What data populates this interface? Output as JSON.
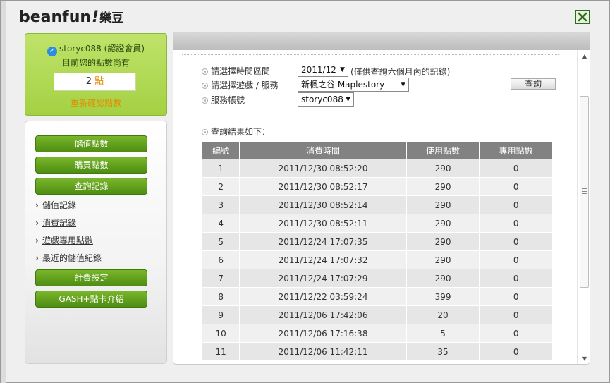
{
  "app": {
    "logo_text": "beanfun",
    "logo_bang": "!",
    "logo_cn": "樂豆"
  },
  "account": {
    "username_line": "storyc088 (認證會員)",
    "points_line": "目前您的點數尚有",
    "points_value": "2",
    "points_unit": "點",
    "recheck_label": "重新確認點數"
  },
  "menu": {
    "buttons": [
      "儲值點數",
      "購買點數",
      "查詢記錄"
    ],
    "links": [
      "儲值記錄",
      "消費記錄",
      "遊戲專用點數",
      "最近的儲值紀錄"
    ],
    "bottom_buttons": [
      "計費設定",
      "GASH+點卡介紹"
    ]
  },
  "form": {
    "period_label": "請選擇時間區間",
    "period_value": "2011/12",
    "period_hint": "(僅供查詢六個月內的記錄)",
    "game_label": "請選擇遊戲 / 服務",
    "game_value": "新楓之谷 Maplestory",
    "account_label": "服務帳號",
    "account_value": "storyc088",
    "query_button": "查詢"
  },
  "results": {
    "label": "查詢結果如下：",
    "columns": [
      "編號",
      "消費時間",
      "使用點數",
      "專用點數"
    ],
    "rows": [
      [
        "1",
        "2011/12/30 08:52:20",
        "290",
        "0"
      ],
      [
        "2",
        "2011/12/30 08:52:17",
        "290",
        "0"
      ],
      [
        "3",
        "2011/12/30 08:52:14",
        "290",
        "0"
      ],
      [
        "4",
        "2011/12/30 08:52:11",
        "290",
        "0"
      ],
      [
        "5",
        "2011/12/24 17:07:35",
        "290",
        "0"
      ],
      [
        "6",
        "2011/12/24 17:07:32",
        "290",
        "0"
      ],
      [
        "7",
        "2011/12/24 17:07:29",
        "290",
        "0"
      ],
      [
        "8",
        "2011/12/22 03:59:24",
        "399",
        "0"
      ],
      [
        "9",
        "2011/12/06 17:42:06",
        "20",
        "0"
      ],
      [
        "10",
        "2011/12/06 17:16:38",
        "5",
        "0"
      ],
      [
        "11",
        "2011/12/06 11:42:11",
        "35",
        "0"
      ]
    ]
  },
  "colors": {
    "accent_green": "#5a9a1a",
    "link_orange": "#e38b00",
    "table_header": "#828282"
  }
}
